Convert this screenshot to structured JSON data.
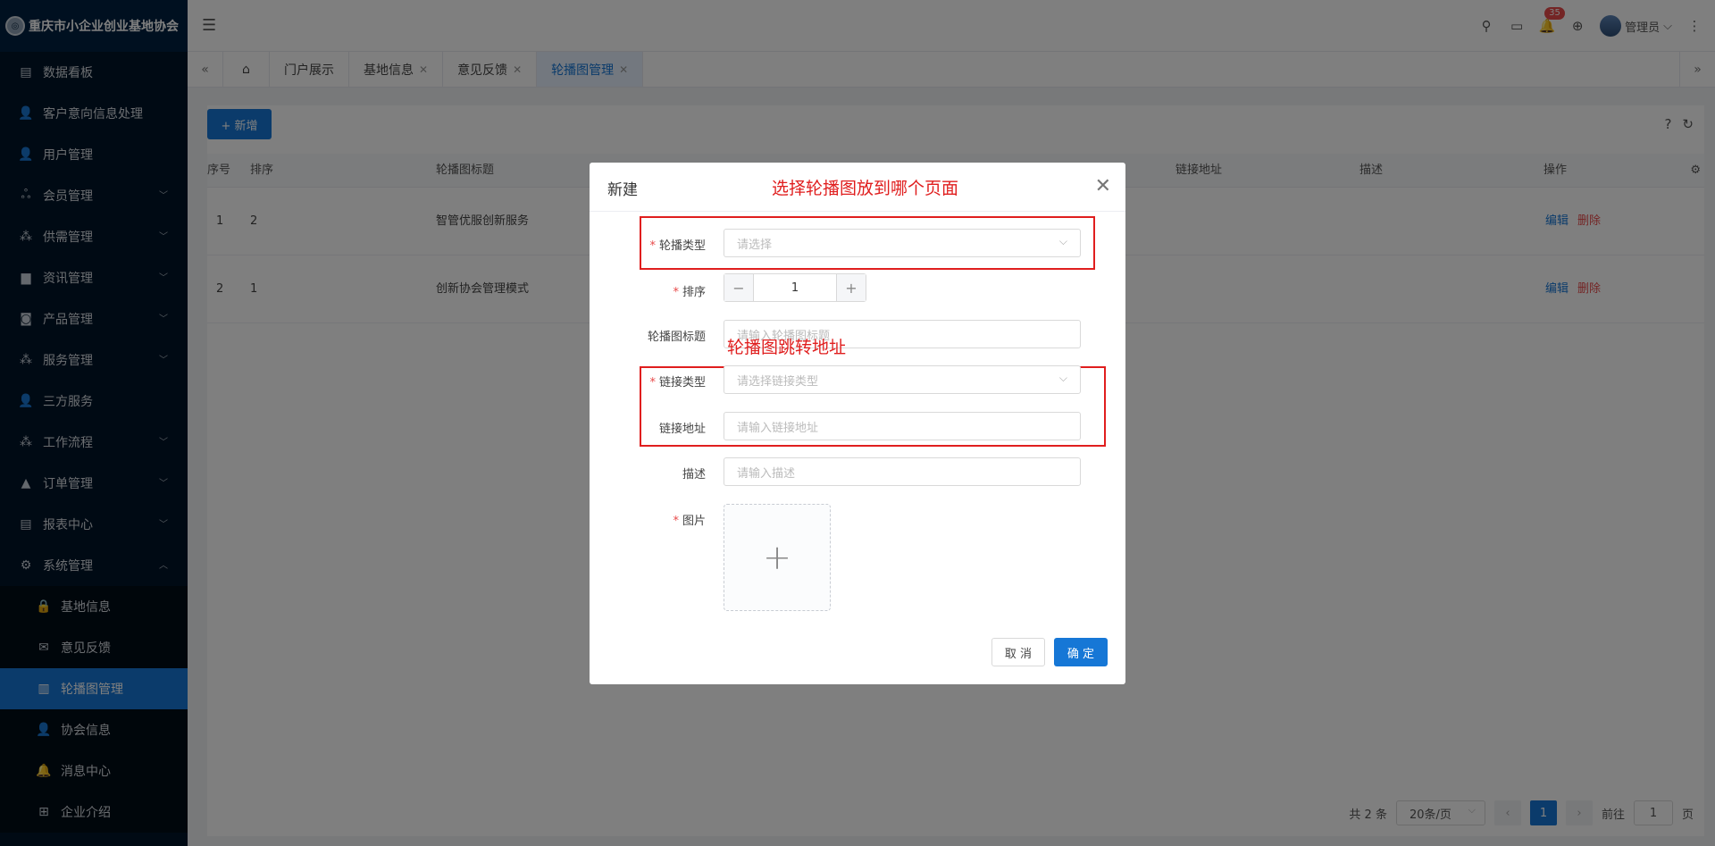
{
  "app": {
    "title": "重庆市小企业创业基地协会"
  },
  "sidebar": {
    "items": [
      {
        "label": "数据看板",
        "icon": "dashboard-icon"
      },
      {
        "label": "客户意向信息处理",
        "icon": "user-icon"
      },
      {
        "label": "用户管理",
        "icon": "user-icon"
      },
      {
        "label": "会员管理",
        "icon": "members-icon"
      },
      {
        "label": "供需管理",
        "icon": "grid-icon"
      },
      {
        "label": "资讯管理",
        "icon": "document-icon"
      },
      {
        "label": "产品管理",
        "icon": "product-icon"
      },
      {
        "label": "服务管理",
        "icon": "grid-icon"
      },
      {
        "label": "三方服务",
        "icon": "user-icon"
      },
      {
        "label": "工作流程",
        "icon": "workflow-icon"
      },
      {
        "label": "订单管理",
        "icon": "triangle-icon"
      },
      {
        "label": "报表中心",
        "icon": "report-icon"
      },
      {
        "label": "系统管理",
        "icon": "gear-icon"
      }
    ],
    "system_sub": [
      {
        "label": "基地信息",
        "icon": "lock-icon"
      },
      {
        "label": "意见反馈",
        "icon": "mail-icon"
      },
      {
        "label": "轮播图管理",
        "icon": "map-icon"
      },
      {
        "label": "协会信息",
        "icon": "user-icon"
      },
      {
        "label": "消息中心",
        "icon": "bell-icon"
      },
      {
        "label": "企业介绍",
        "icon": "table-icon"
      }
    ]
  },
  "header": {
    "notification_count": "35",
    "user_name": "管理员"
  },
  "tabs": [
    "门户展示",
    "基地信息",
    "意见反馈",
    "轮播图管理"
  ],
  "toolbar": {
    "add_label": "+ 新增"
  },
  "table": {
    "columns": [
      "序号",
      "排序",
      "轮播图标题",
      "链接地址",
      "描述",
      "操作"
    ],
    "rows": [
      {
        "index": "1",
        "sort": "2",
        "title": "智管优服创新服务"
      },
      {
        "index": "2",
        "sort": "1",
        "title": "创新协会管理模式"
      }
    ],
    "edit_label": "编辑",
    "delete_label": "删除"
  },
  "pagination": {
    "total": "共 2 条",
    "page_size": "20条/页",
    "current": "1",
    "goto_label": "前往",
    "goto_value": "1",
    "page_suffix": "页"
  },
  "modal": {
    "title": "新建",
    "annotation_top": "选择轮播图放到哪个页面",
    "annotation_mid": "轮播图跳转地址",
    "fields": {
      "carousel_type": {
        "label": "轮播类型",
        "placeholder": "请选择"
      },
      "sort": {
        "label": "排序",
        "value": "1"
      },
      "title": {
        "label": "轮播图标题",
        "placeholder": "请输入轮播图标题"
      },
      "link_type": {
        "label": "链接类型",
        "placeholder": "请选择链接类型"
      },
      "link_url": {
        "label": "链接地址",
        "placeholder": "请输入链接地址"
      },
      "description": {
        "label": "描述",
        "placeholder": "请输入描述"
      },
      "image": {
        "label": "图片"
      }
    },
    "cancel_label": "取 消",
    "ok_label": "确 定"
  },
  "colors": {
    "primary": "#1677d6",
    "sidebar_bg": "#001529",
    "annotation": "#e01e1e",
    "danger": "#e84a4a"
  }
}
